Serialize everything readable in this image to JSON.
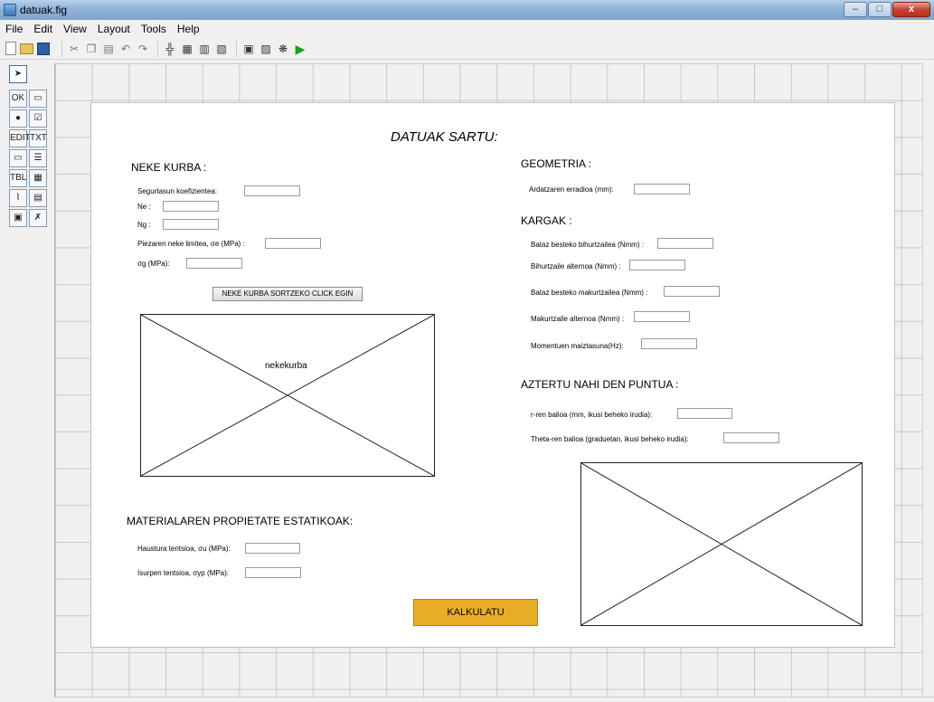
{
  "window": {
    "title": "datuak.fig",
    "min_label": "–",
    "max_label": "□",
    "close_label": "x"
  },
  "menu": {
    "items": [
      "File",
      "Edit",
      "View",
      "Layout",
      "Tools",
      "Help"
    ]
  },
  "toolbar": {
    "icons": [
      "new-file-icon",
      "open-folder-icon",
      "save-icon",
      "cut-icon",
      "copy-icon",
      "paste-icon",
      "undo-icon",
      "redo-icon",
      "align-icon",
      "menu-editor-icon",
      "tab-order-icon",
      "toolbar-editor-icon",
      "mfile-editor-icon",
      "property-inspector-icon",
      "object-browser-icon",
      "run-icon"
    ]
  },
  "palette": {
    "items": [
      "select-tool",
      "push-button",
      "slider",
      "radio-button",
      "checkbox",
      "edit-text",
      "static-text",
      "popup-menu",
      "listbox",
      "toggle-button",
      "table",
      "axes",
      "panel",
      "button-group",
      "activex-control"
    ],
    "labels": {
      "push": "OK",
      "edit": "EDIT",
      "static": "TXT",
      "table": "TBL"
    }
  },
  "form": {
    "main_title": "DATUAK SARTU:",
    "neke": {
      "heading": "NEKE KURBA :",
      "segurtasun_label": "Segurtasun koefizientea:",
      "ne_label": "Ne :",
      "ng_label": "Ng :",
      "neke_limitea_label": "Piezaren neke limitea, σe (MPa) :",
      "sigma_g_label": "σg (MPa):",
      "button_label": "NEKE KURBA SORTZEKO CLICK EGIN",
      "axes_label": "nekekurba"
    },
    "material": {
      "heading": "MATERIALAREN PROPIETATE ESTATIKOAK:",
      "haustura_label": "Haustura tentsioa, σu (MPa):",
      "isurpen_label": "Isurpen tentsioa, σyp (MPa):"
    },
    "geometria": {
      "heading": "GEOMETRIA :",
      "erradioa_label": "Ardatzaren erradioa (mm):"
    },
    "kargak": {
      "heading": "KARGAK :",
      "bihurtzailea_label": "Bataz besteko bihurtzailea (Nmm) :",
      "bihurtzaile_alternoa_label": "Bihurtzaile alternoa (Nmm) :",
      "makurtzailea_label": "Bataz besteko makurtzailea (Nmm) :",
      "makurtzaile_alternoa_label": "Makurtzaile alternoa (Nmm) :",
      "maiztasuna_label": "Momentuen maiztasuna(Hz):"
    },
    "puntua": {
      "heading": "AZTERTU NAHI DEN PUNTUA :",
      "r_label": "r-ren balioa (mm, ikusi beheko irudia):",
      "theta_label": "Theta-ren balioa (graduetan, ikusi beheko irudia):"
    },
    "calc_button": "KALKULATU"
  },
  "colors": {
    "calc_button": "#e9ad25",
    "titlebar": "#8fb2d8",
    "run_icon": "#12a312"
  }
}
